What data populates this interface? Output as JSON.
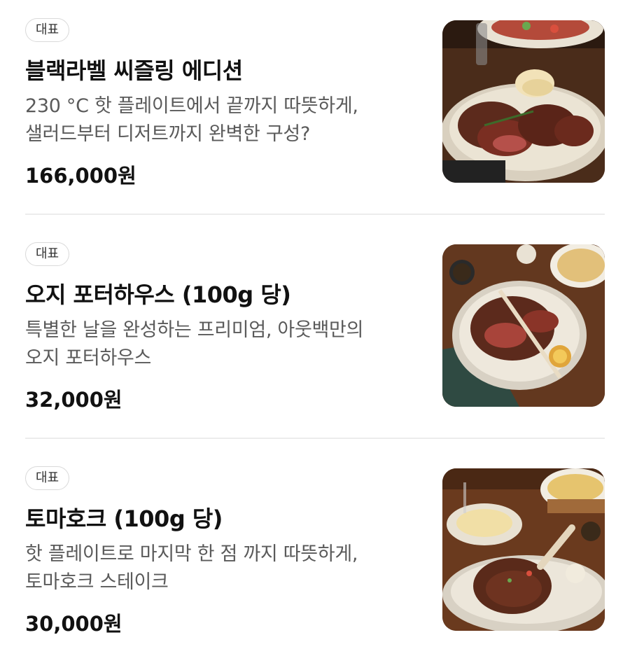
{
  "menu": {
    "items": [
      {
        "badge": "대표",
        "title": "블랙라벨 씨즐링 에디션",
        "desc_line1": "230 °C 핫 플레이트에서 끝까지 따뜻하게,",
        "desc_line2": "샐러드부터 디저트까지 완벽한 구성?",
        "price": "166,000원"
      },
      {
        "badge": "대표",
        "title": "오지 포터하우스 (100g 당)",
        "desc_line1": "특별한 날을 완성하는 프리미엄, 아웃백만의",
        "desc_line2": "오지 포터하우스",
        "price": "32,000원"
      },
      {
        "badge": "대표",
        "title": "토마호크 (100g 당)",
        "desc_line1": "핫 플레이트로 마지막 한 점 까지 따뜻하게,",
        "desc_line2": "토마호크 스테이크",
        "price": "30,000원"
      }
    ]
  },
  "colors": {
    "badge_border": "#d9d9d9",
    "description_text": "#5a5a5a",
    "title_text": "#111111",
    "divider": "#ececec"
  }
}
